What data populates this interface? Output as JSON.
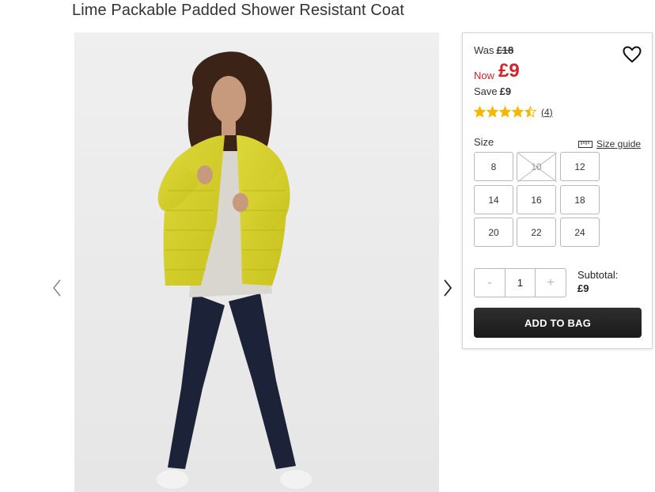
{
  "product": {
    "title": "Lime Packable Padded Shower Resistant Coat"
  },
  "gallery": {
    "prev_icon": "chevron-left-icon",
    "next_icon": "chevron-right-icon"
  },
  "pricing": {
    "was_label": "Was",
    "was_price": "£18",
    "now_label": "Now",
    "now_price": "£9",
    "save_label": "Save",
    "save_amount": "£9",
    "accent_color": "#d1232a"
  },
  "rating": {
    "value": 4.5,
    "max": 5,
    "review_count": "(4)",
    "star_color": "#f5b800"
  },
  "sizes": {
    "label": "Size",
    "guide_label": "Size guide",
    "guide_icon": "ruler-icon",
    "options": [
      {
        "label": "8",
        "available": true
      },
      {
        "label": "10",
        "available": false
      },
      {
        "label": "12",
        "available": true
      },
      {
        "label": "14",
        "available": true
      },
      {
        "label": "16",
        "available": true
      },
      {
        "label": "18",
        "available": true
      },
      {
        "label": "20",
        "available": true
      },
      {
        "label": "22",
        "available": true
      },
      {
        "label": "24",
        "available": true
      }
    ]
  },
  "quantity": {
    "minus": "-",
    "value": "1",
    "plus": "+"
  },
  "subtotal": {
    "label": "Subtotal:",
    "value": "£9"
  },
  "cart": {
    "add_label": "ADD TO BAG"
  },
  "wishlist": {
    "icon": "heart-icon"
  }
}
